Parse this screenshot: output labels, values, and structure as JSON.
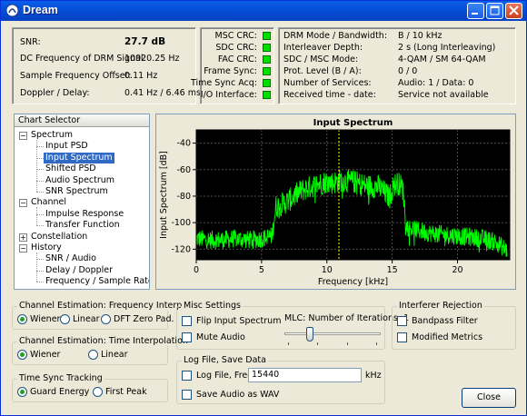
{
  "window": {
    "title": "Dream"
  },
  "status": {
    "snr_label": "SNR:",
    "snr_value": "27.7 dB",
    "dc_label": "DC Frequency of DRM Signal:",
    "dc_value": "10920.25 Hz",
    "sfo_label": "Sample Frequency Offset:",
    "sfo_value": "0.11 Hz",
    "doppler_label": "Doppler / Delay:",
    "doppler_value": "0.41 Hz / 6.46 ms"
  },
  "crc": [
    "MSC CRC:",
    "SDC CRC:",
    "FAC CRC:",
    "Frame Sync:",
    "Time Sync Acq:",
    "I/O Interface:"
  ],
  "crc_color": "#00e000",
  "drm": {
    "labels": [
      "DRM Mode / Bandwidth:",
      "Interleaver Depth:",
      "SDC / MSC Mode:",
      "Prot. Level (B / A):",
      "Number of Services:",
      "Received time - date:"
    ],
    "values": [
      "B / 10 kHz",
      "2 s (Long Interleaving)",
      "4-QAM / SM 64-QAM",
      "0 / 0",
      "Audio: 1 / Data: 0",
      "Service not available"
    ]
  },
  "tree": {
    "header": "Chart Selector",
    "items": [
      {
        "label": "Spectrum",
        "level": 0,
        "sign": "−"
      },
      {
        "label": "Input PSD",
        "level": 1
      },
      {
        "label": "Input Spectrum",
        "level": 1,
        "selected": true
      },
      {
        "label": "Shifted PSD",
        "level": 1
      },
      {
        "label": "Audio Spectrum",
        "level": 1
      },
      {
        "label": "SNR Spectrum",
        "level": 1
      },
      {
        "label": "Channel",
        "level": 0,
        "sign": "−"
      },
      {
        "label": "Impulse Response",
        "level": 1
      },
      {
        "label": "Transfer Function",
        "level": 1
      },
      {
        "label": "Constellation",
        "level": 0,
        "sign": "+"
      },
      {
        "label": "History",
        "level": 0,
        "sign": "−"
      },
      {
        "label": "SNR / Audio",
        "level": 1
      },
      {
        "label": "Delay / Doppler",
        "level": 1
      },
      {
        "label": "Frequency / Sample Rate",
        "level": 1
      }
    ]
  },
  "chart_data": {
    "type": "line",
    "title": "Input Spectrum",
    "xlabel": "Frequency [kHz]",
    "ylabel": "Input Spectrum [dB]",
    "xlim": [
      0,
      24
    ],
    "ylim": [
      -128,
      -30
    ],
    "xticks": [
      0,
      5,
      10,
      15,
      20
    ],
    "yticks": [
      -40,
      -60,
      -80,
      -100,
      -120
    ],
    "grid": true,
    "background": "#000000",
    "line_color": "#00ff00",
    "marker_color": "#ffff00",
    "marker_x": 10.92,
    "series": [
      {
        "x": [
          0,
          1,
          2,
          3,
          4,
          5,
          5.8,
          6.1,
          7,
          8,
          9,
          10,
          10.5,
          11,
          12,
          13,
          14,
          14.8,
          15.1,
          15.4,
          15.8,
          16.1,
          17,
          18,
          19,
          20,
          21,
          22,
          23,
          23.8
        ],
        "y": [
          -112,
          -113,
          -113,
          -112,
          -113,
          -112,
          -110,
          -88,
          -84,
          -76,
          -72,
          -69,
          -70,
          -68,
          -69,
          -72,
          -73,
          -81,
          -72,
          -70,
          -73,
          -103,
          -106,
          -108,
          -109,
          -110,
          -111,
          -112,
          -115,
          -121
        ]
      }
    ]
  },
  "freq_interp": {
    "title": "Channel Estimation: Frequency Interpolation",
    "options": [
      "Wiener",
      "Linear",
      "DFT Zero Pad."
    ],
    "selected": 0
  },
  "time_interp": {
    "title": "Channel Estimation: Time Interpolation",
    "options": [
      "Wiener",
      "Linear"
    ],
    "selected": 0
  },
  "time_sync": {
    "title": "Time Sync Tracking",
    "options": [
      "Guard Energy",
      "First Peak"
    ],
    "selected": 0
  },
  "misc": {
    "title": "Misc Settings",
    "flip": "Flip Input Spectrum",
    "mute": "Mute Audio",
    "mlc_label": "MLC: Number of Iterations: 1",
    "mlc_value": 1,
    "mlc_max": 4
  },
  "logfile": {
    "title": "Log File, Save Data",
    "freq_label": "Log File, Freq:",
    "freq_value": "15440",
    "unit": "kHz",
    "wav_label": "Save Audio as WAV"
  },
  "interferer": {
    "title": "Interferer Rejection",
    "bandpass": "Bandpass Filter",
    "modified": "Modified Metrics"
  },
  "close_label": "Close"
}
